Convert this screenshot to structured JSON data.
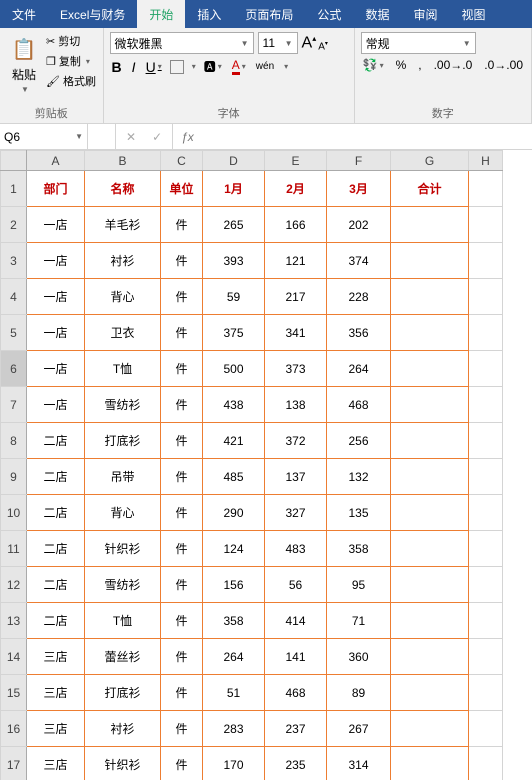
{
  "menubar": {
    "items": [
      "文件",
      "Excel与财务",
      "开始",
      "插入",
      "页面布局",
      "公式",
      "数据",
      "审阅",
      "视图"
    ],
    "activeIndex": 2
  },
  "ribbon": {
    "clipboard": {
      "paste": "粘贴",
      "cut": "剪切",
      "copy": "复制",
      "formatPainter": "格式刷",
      "groupLabel": "剪贴板"
    },
    "font": {
      "name": "微软雅黑",
      "size": "11",
      "groupLabel": "字体",
      "wen": "wén"
    },
    "number": {
      "format": "常规",
      "groupLabel": "数字"
    }
  },
  "formulaBar": {
    "nameBox": "Q6",
    "formula": ""
  },
  "sheet": {
    "activeRow": 6,
    "columns": [
      "A",
      "B",
      "C",
      "D",
      "E",
      "F",
      "G",
      "H"
    ],
    "headers": [
      "部门",
      "名称",
      "单位",
      "1月",
      "2月",
      "3月",
      "合计"
    ],
    "rows": [
      {
        "dept": "一店",
        "name": "羊毛衫",
        "unit": "件",
        "m1": "265",
        "m2": "166",
        "m3": "202",
        "sum": ""
      },
      {
        "dept": "一店",
        "name": "衬衫",
        "unit": "件",
        "m1": "393",
        "m2": "121",
        "m3": "374",
        "sum": ""
      },
      {
        "dept": "一店",
        "name": "背心",
        "unit": "件",
        "m1": "59",
        "m2": "217",
        "m3": "228",
        "sum": ""
      },
      {
        "dept": "一店",
        "name": "卫衣",
        "unit": "件",
        "m1": "375",
        "m2": "341",
        "m3": "356",
        "sum": ""
      },
      {
        "dept": "一店",
        "name": "T恤",
        "unit": "件",
        "m1": "500",
        "m2": "373",
        "m3": "264",
        "sum": ""
      },
      {
        "dept": "一店",
        "name": "雪纺衫",
        "unit": "件",
        "m1": "438",
        "m2": "138",
        "m3": "468",
        "sum": ""
      },
      {
        "dept": "二店",
        "name": "打底衫",
        "unit": "件",
        "m1": "421",
        "m2": "372",
        "m3": "256",
        "sum": ""
      },
      {
        "dept": "二店",
        "name": "吊带",
        "unit": "件",
        "m1": "485",
        "m2": "137",
        "m3": "132",
        "sum": ""
      },
      {
        "dept": "二店",
        "name": "背心",
        "unit": "件",
        "m1": "290",
        "m2": "327",
        "m3": "135",
        "sum": ""
      },
      {
        "dept": "二店",
        "name": "针织衫",
        "unit": "件",
        "m1": "124",
        "m2": "483",
        "m3": "358",
        "sum": ""
      },
      {
        "dept": "二店",
        "name": "雪纺衫",
        "unit": "件",
        "m1": "156",
        "m2": "56",
        "m3": "95",
        "sum": ""
      },
      {
        "dept": "二店",
        "name": "T恤",
        "unit": "件",
        "m1": "358",
        "m2": "414",
        "m3": "71",
        "sum": ""
      },
      {
        "dept": "三店",
        "name": "蕾丝衫",
        "unit": "件",
        "m1": "264",
        "m2": "141",
        "m3": "360",
        "sum": ""
      },
      {
        "dept": "三店",
        "name": "打底衫",
        "unit": "件",
        "m1": "51",
        "m2": "468",
        "m3": "89",
        "sum": ""
      },
      {
        "dept": "三店",
        "name": "衬衫",
        "unit": "件",
        "m1": "283",
        "m2": "237",
        "m3": "267",
        "sum": ""
      },
      {
        "dept": "三店",
        "name": "针织衫",
        "unit": "件",
        "m1": "170",
        "m2": "235",
        "m3": "314",
        "sum": ""
      }
    ]
  }
}
